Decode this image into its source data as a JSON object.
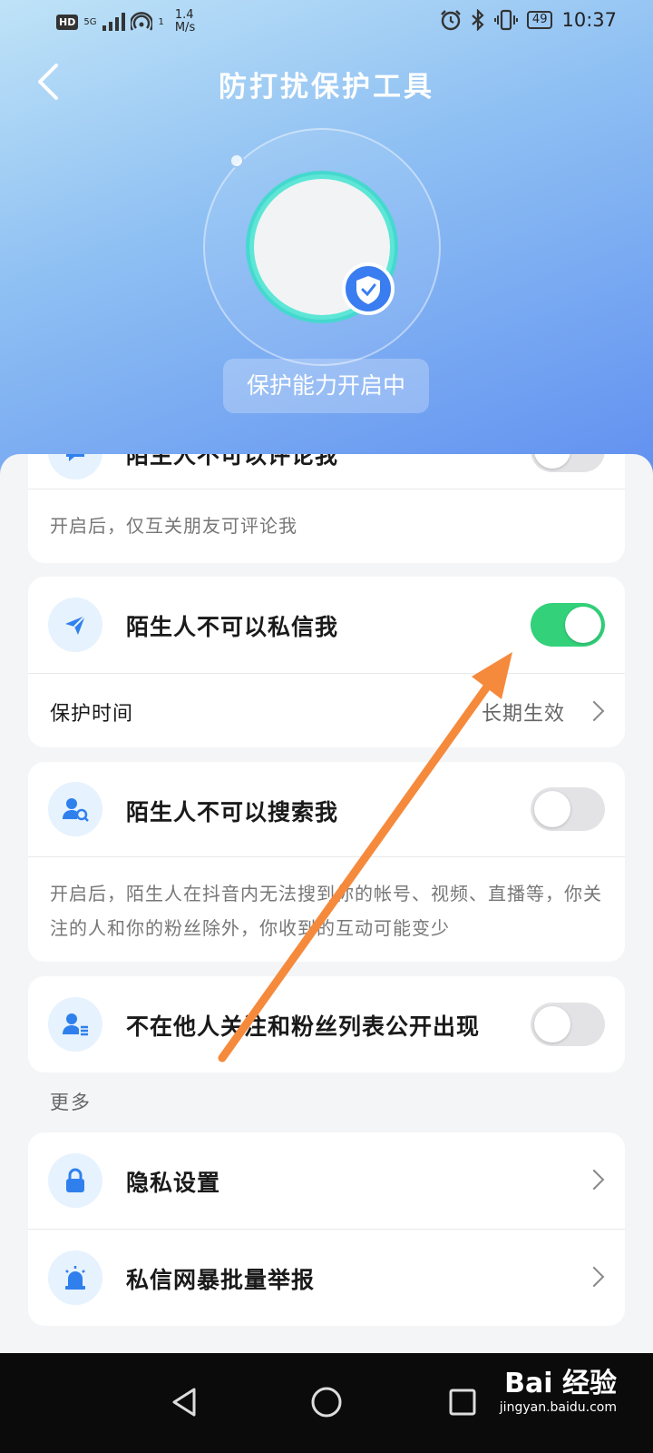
{
  "status_bar": {
    "network_hd": "HD",
    "network_5g": "5G",
    "hotspot_count": "1",
    "speed_value": "1.4",
    "speed_unit": "M/s",
    "battery": "49",
    "time": "10:37"
  },
  "header": {
    "title": "防打扰保护工具",
    "status": "保护能力开启中"
  },
  "cards": {
    "comment": {
      "label": "陌生人不可以评论我",
      "enabled": false,
      "description": "开启后，仅互关朋友可评论我"
    },
    "message": {
      "label": "陌生人不可以私信我",
      "enabled": true,
      "time_label": "保护时间",
      "time_value": "长期生效"
    },
    "search": {
      "label": "陌生人不可以搜索我",
      "enabled": false,
      "description": "开启后，陌生人在抖音内无法搜到你的帐号、视频、直播等，你关注的人和你的粉丝除外，你收到的互动可能变少"
    },
    "follow_list": {
      "label": "不在他人关注和粉丝列表公开出现",
      "enabled": false
    }
  },
  "more": {
    "section_label": "更多",
    "items": [
      {
        "label": "隐私设置",
        "icon": "lock-icon"
      },
      {
        "label": "私信网暴批量举报",
        "icon": "alarm-icon"
      }
    ]
  },
  "watermark": {
    "brand": "Bai 经验",
    "url": "jingyan.baidu.com"
  },
  "colors": {
    "accent_green": "#33d17a",
    "icon_blue": "#2f80ed",
    "annotation_arrow": "#f58a3d"
  }
}
